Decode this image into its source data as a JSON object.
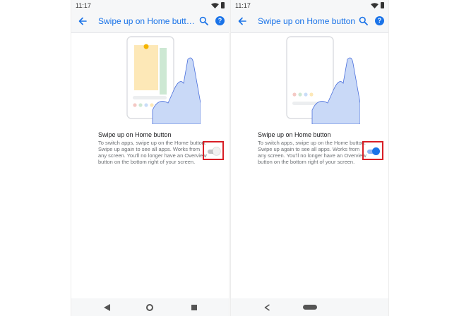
{
  "colors": {
    "accent": "#1a73e8",
    "highlight_border": "#d81f26",
    "app_bar_bg": "#f6f7f8"
  },
  "screens": [
    {
      "status": {
        "time": "11:17",
        "icons": [
          "wifi-icon",
          "battery-icon"
        ]
      },
      "app_bar": {
        "back_icon": "back-arrow-icon",
        "title": "Swipe up on Home butt…",
        "search_icon": "search-icon",
        "help_icon": "help-icon",
        "help_glyph": "?"
      },
      "illustration": "phone-with-recent-apps-overview",
      "setting": {
        "title": "Swipe up on Home button",
        "description": "To switch apps, swipe up on the Home button. Swipe up again to see all apps. Works from any screen. You'll no longer have an Overview button on the bottom right of your screen.",
        "toggle_state": "off"
      },
      "nav_bar": {
        "icons": [
          "back-triangle-icon",
          "home-circle-icon",
          "overview-square-icon"
        ]
      }
    },
    {
      "status": {
        "time": "11:17",
        "icons": [
          "wifi-icon",
          "battery-icon"
        ]
      },
      "app_bar": {
        "back_icon": "back-arrow-icon",
        "title": "Swipe up on Home button",
        "search_icon": "search-icon",
        "help_icon": "help-icon",
        "help_glyph": "?"
      },
      "illustration": "phone-with-home-screen",
      "setting": {
        "title": "Swipe up on Home button",
        "description": "To switch apps, swipe up on the Home button. Swipe up again to see all apps. Works from any screen. You'll no longer have an Overview button on the bottom right of your screen.",
        "toggle_state": "on"
      },
      "nav_bar": {
        "icons": [
          "back-triangle-icon",
          "home-pill-icon"
        ]
      }
    }
  ]
}
